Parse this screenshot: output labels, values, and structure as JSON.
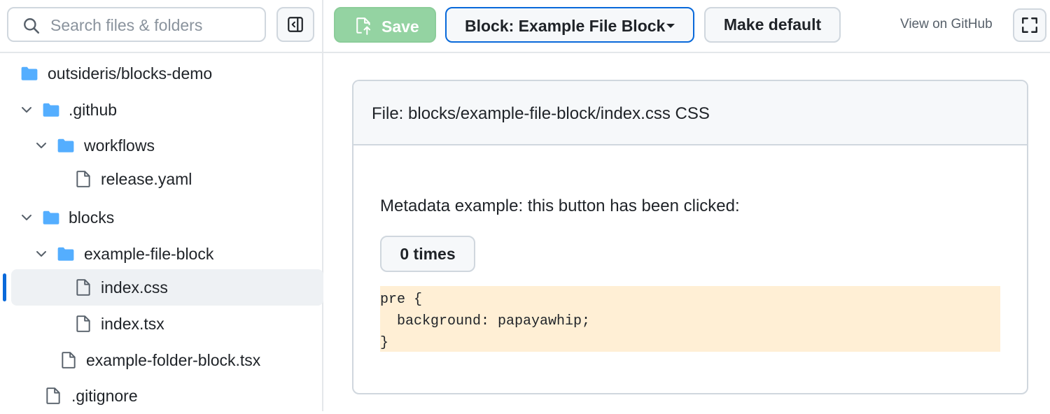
{
  "search": {
    "placeholder": "Search files & folders"
  },
  "toolbar": {
    "save_label": "Save",
    "block_label": "Block: Example File Block",
    "make_default_label": "Make default",
    "github_link": "View on GitHub"
  },
  "tree": {
    "repo": "outsideris/blocks-demo",
    "github_dir": ".github",
    "workflows_dir": "workflows",
    "release_file": "release.yaml",
    "blocks_dir": "blocks",
    "example_file_block_dir": "example-file-block",
    "index_css": "index.css",
    "index_tsx": "index.tsx",
    "example_folder_block": "example-folder-block.tsx",
    "gitignore": ".gitignore"
  },
  "file": {
    "header": "File: blocks/example-file-block/index.css CSS",
    "metadata_text": "Metadata example: this button has been clicked:",
    "clicks_button": "0 times",
    "code": [
      "pre {",
      "  background: papayawhip;",
      "}"
    ]
  },
  "colors": {
    "accent": "#0969da",
    "save_green": "#94d3a2",
    "folder_blue": "#54aeff",
    "code_background": "#ffefd5"
  }
}
